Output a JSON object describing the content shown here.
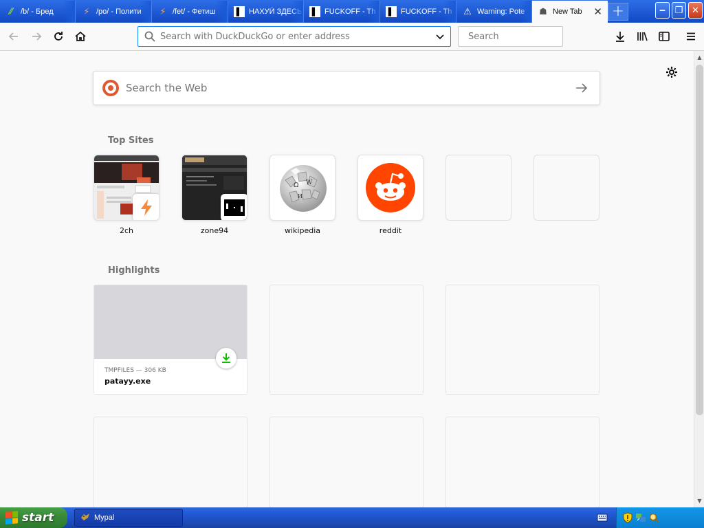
{
  "tabs": [
    {
      "label": "/b/ - Бред",
      "icon": "2ch-icon",
      "icon_glyph": "⁄⁄",
      "icon_color": "#7fd04a"
    },
    {
      "label": "/po/ - Полити",
      "icon": "lightning-icon",
      "icon_glyph": "⚡",
      "icon_color": "#f5a05a"
    },
    {
      "label": "/fet/ - Фетиш",
      "icon": "lightning-icon",
      "icon_glyph": "⚡",
      "icon_color": "#f5a05a"
    },
    {
      "label": "НАХУЙ ЗДЕСЬ",
      "icon": "figure-icon",
      "icon_glyph": "▌",
      "icon_color": "#ffffff"
    },
    {
      "label": "FUCKOFF - Th",
      "icon": "figure-icon",
      "icon_glyph": "▌",
      "icon_color": "#ffffff"
    },
    {
      "label": "FUCKOFF - Th",
      "icon": "figure-icon",
      "icon_glyph": "▌",
      "icon_color": "#ffffff"
    },
    {
      "label": "Warning: Pote",
      "icon": "warning-icon",
      "icon_glyph": "⚠",
      "icon_color": "#ffffff"
    },
    {
      "label": "New Tab",
      "icon": "tab-favicon-icon",
      "icon_glyph": "☗",
      "icon_color": "#555555",
      "active": true
    }
  ],
  "newtab_button": "+",
  "window_controls": {
    "minimize": "‒",
    "maximize": "❐",
    "close": "✕"
  },
  "navbar": {
    "url_placeholder": "Search with DuckDuckGo or enter address",
    "search_placeholder": "Search"
  },
  "newtab": {
    "search_placeholder": "Search the Web",
    "top_sites_title": "Top Sites",
    "highlights_title": "Highlights",
    "top_sites": [
      {
        "label": "2ch"
      },
      {
        "label": "zone94"
      },
      {
        "label": "wikipedia"
      },
      {
        "label": "reddit"
      },
      {
        "label": ""
      },
      {
        "label": ""
      }
    ],
    "highlight": {
      "meta": "TMPFILES — 306 KB",
      "filename": "patayy.exe"
    }
  },
  "taskbar": {
    "start_label": "start",
    "task_label": "Mypal"
  },
  "colors": {
    "accent": "#0a84ff",
    "tabstrip": "#1a5ad6",
    "reddit": "#ff4500",
    "download_green": "#12bc00",
    "ddg": "#de5833"
  }
}
